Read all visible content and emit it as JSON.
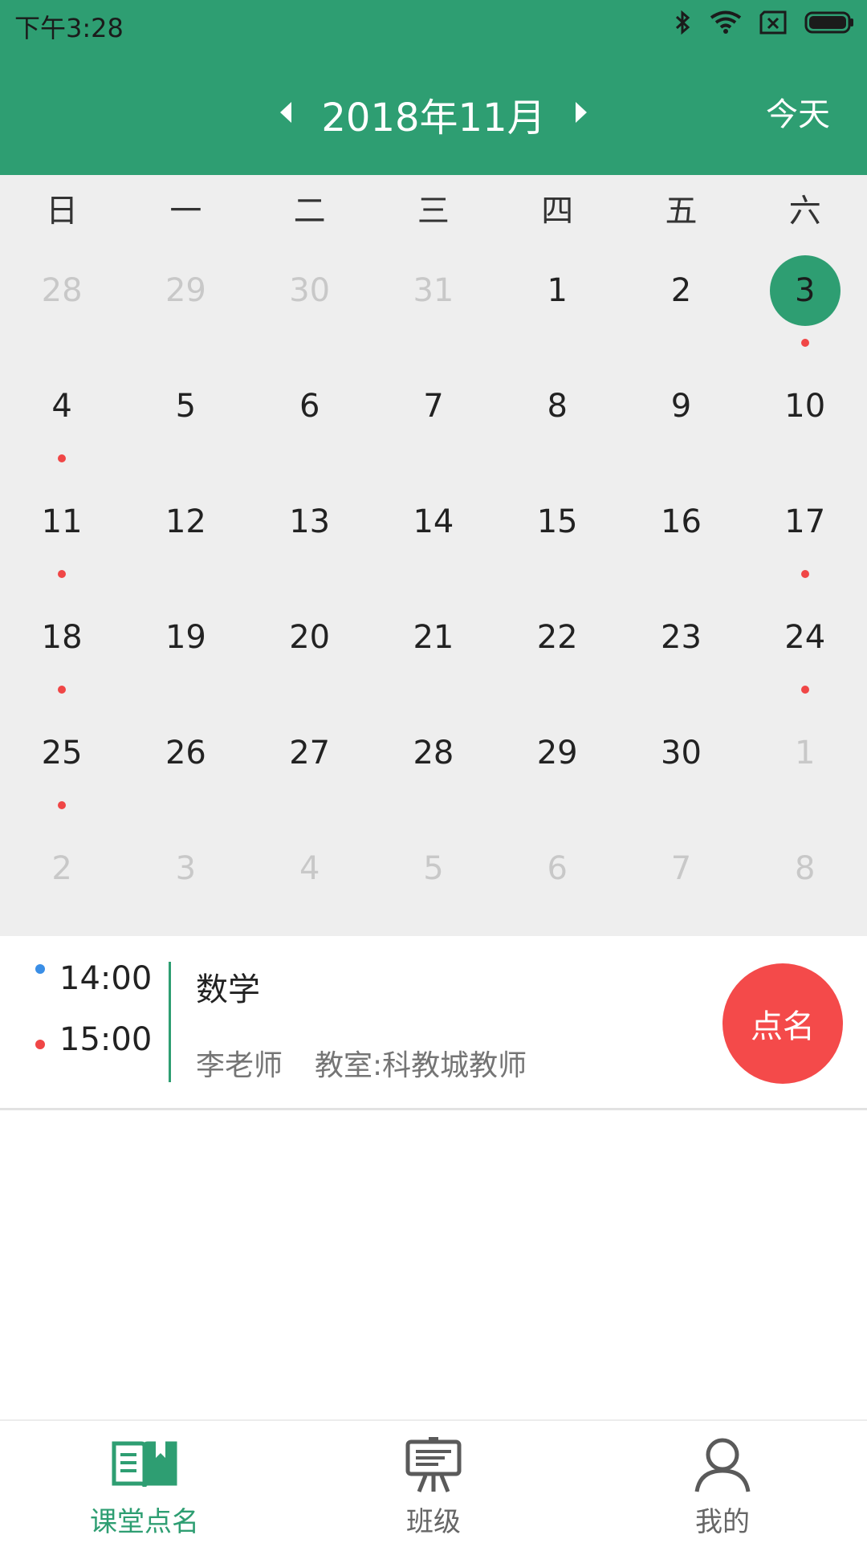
{
  "status_bar": {
    "time": "下午3:28",
    "icons": [
      "bluetooth-icon",
      "wifi-icon",
      "sim-error-icon",
      "battery-icon"
    ]
  },
  "header": {
    "month_label": "2018年11月",
    "prev_icon": "chevron-left-icon",
    "next_icon": "chevron-right-icon",
    "today_label": "今天",
    "background": "#2e9e72"
  },
  "calendar": {
    "weekdays": [
      "日",
      "一",
      "二",
      "三",
      "四",
      "五",
      "六"
    ],
    "weeks": [
      [
        {
          "n": "28",
          "other": true
        },
        {
          "n": "29",
          "other": true
        },
        {
          "n": "30",
          "other": true
        },
        {
          "n": "31",
          "other": true
        },
        {
          "n": "1"
        },
        {
          "n": "2"
        },
        {
          "n": "3",
          "selected": true,
          "dot": true
        }
      ],
      [
        {
          "n": "4",
          "dot": true
        },
        {
          "n": "5"
        },
        {
          "n": "6"
        },
        {
          "n": "7"
        },
        {
          "n": "8"
        },
        {
          "n": "9"
        },
        {
          "n": "10"
        }
      ],
      [
        {
          "n": "11",
          "dot": true
        },
        {
          "n": "12"
        },
        {
          "n": "13"
        },
        {
          "n": "14"
        },
        {
          "n": "15"
        },
        {
          "n": "16"
        },
        {
          "n": "17",
          "dot": true
        }
      ],
      [
        {
          "n": "18",
          "dot": true
        },
        {
          "n": "19"
        },
        {
          "n": "20"
        },
        {
          "n": "21"
        },
        {
          "n": "22"
        },
        {
          "n": "23"
        },
        {
          "n": "24",
          "dot": true
        }
      ],
      [
        {
          "n": "25",
          "dot": true
        },
        {
          "n": "26"
        },
        {
          "n": "27"
        },
        {
          "n": "28"
        },
        {
          "n": "29"
        },
        {
          "n": "30"
        },
        {
          "n": "1",
          "other": true
        }
      ],
      [
        {
          "n": "2",
          "other": true
        },
        {
          "n": "3",
          "other": true
        },
        {
          "n": "4",
          "other": true
        },
        {
          "n": "5",
          "other": true
        },
        {
          "n": "6",
          "other": true
        },
        {
          "n": "7",
          "other": true
        },
        {
          "n": "8",
          "other": true
        }
      ]
    ],
    "selected_color": "#2e9e72",
    "event_dot_color": "#f04646"
  },
  "lesson": {
    "start_time": "14:00",
    "end_time": "15:00",
    "start_dot_color": "#3a8ee6",
    "end_dot_color": "#f04646",
    "subject": "数学",
    "teacher": "李老师",
    "room": "教室:科教城教师",
    "rollcall_label": "点名",
    "rollcall_color": "#f44a4a"
  },
  "bottom_nav": {
    "items": [
      {
        "label": "课堂点名",
        "icon": "open-book-icon",
        "active": true
      },
      {
        "label": "班级",
        "icon": "classroom-board-icon",
        "active": false
      },
      {
        "label": "我的",
        "icon": "user-profile-icon",
        "active": false
      }
    ]
  }
}
